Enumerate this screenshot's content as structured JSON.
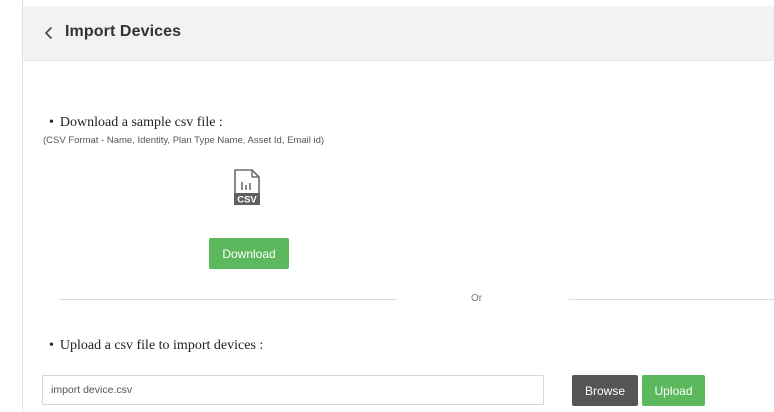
{
  "header": {
    "title": "Import Devices",
    "back_icon": "chevron-left-icon"
  },
  "download_section": {
    "bullet": "•",
    "heading": "Download a sample csv file :",
    "format_note": "(CSV Format - Name, Identity, Plan Type Name, Asset Id, Email id)",
    "file_icon": "csv-file-icon",
    "file_icon_label": "CSV",
    "button_label": "Download"
  },
  "separator": {
    "label": "Or"
  },
  "upload_section": {
    "bullet": "•",
    "heading": "Upload a csv file to import devices :",
    "file_input_value": "import device.csv",
    "browse_label": "Browse",
    "upload_label": "Upload"
  },
  "colors": {
    "header_bg": "#f2f2f2",
    "primary_green": "#5cb85c",
    "browse_gray": "#555555",
    "divider": "#dcdcdc"
  }
}
